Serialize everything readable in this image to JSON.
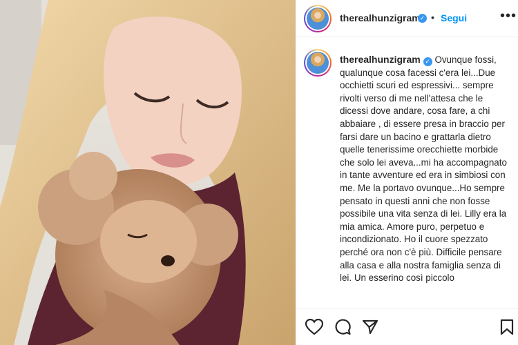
{
  "post": {
    "username": "therealhunzigram",
    "follow_label": "Segui",
    "separator": "•",
    "caption": "Ovunque fossi, qualunque cosa facessi c'era lei...Due occhietti scuri ed espressivi... sempre rivolti verso di me nell'attesa che le dicessi dove andare, cosa fare, a chi abbaiare , di essere presa in braccio per farsi dare un bacino e grattarla dietro quelle tenerissime orecchiette morbide che solo lei aveva...mi ha accompagnato in tante avventure ed era in simbiosi con me. Me la portavo ovunque...Ho sempre pensato in questi anni che non fosse possibile una vita senza di lei. Lilly era la mia amica. Amore puro, perpetuo e incondizionato. Ho il cuore spezzato perché ora non c'è più. Difficile pensare alla casa e alla nostra famiglia senza di lei. Un esserino così piccolo"
  },
  "icons": {
    "verified": "verified-badge-icon",
    "more": "more-options-icon",
    "like": "heart-icon",
    "comment": "comment-icon",
    "share": "send-icon",
    "save": "bookmark-icon"
  },
  "colors": {
    "accent": "#0095f6",
    "verified": "#3897f0",
    "text": "#262626"
  }
}
